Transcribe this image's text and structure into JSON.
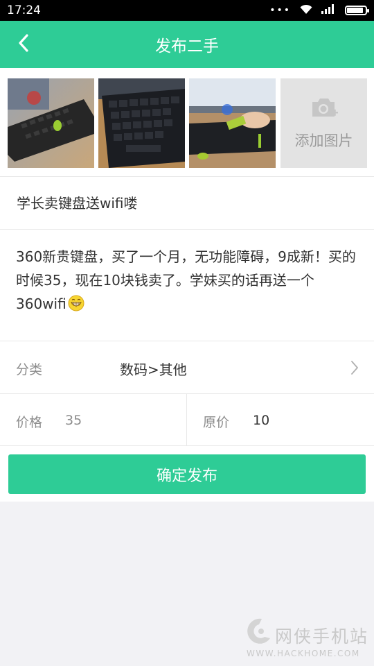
{
  "status_bar": {
    "time": "17:24",
    "notification_dots": "•••",
    "icons": [
      "wifi-icon",
      "signal-icon",
      "battery-icon"
    ],
    "battery_level": 0.9
  },
  "header": {
    "back_icon": "chevron-left-icon",
    "title": "发布二手"
  },
  "photos": [
    {
      "content": "keyboard-photo"
    },
    {
      "content": "keyboard-closeup-photo"
    },
    {
      "content": "usb-wifi-dongle-photo"
    }
  ],
  "add_photo": {
    "icon": "camera-plus-icon",
    "label": "添加图片"
  },
  "post": {
    "title_value": "学长卖键盘送wifi喽",
    "description": "360新贵键盘，买了一个月，无功能障碍，9成新！买的时候35，现在10块钱卖了。学妹买的话再送一个360wifi",
    "description_emoji": "grinning-face-emoji"
  },
  "category": {
    "label": "分类",
    "value": "数码>其他",
    "chevron_icon": "chevron-right-icon"
  },
  "price": {
    "label": "价格",
    "value": "35"
  },
  "original_price": {
    "label": "原价",
    "value": "10"
  },
  "submit": {
    "label": "确定发布"
  },
  "watermark": {
    "name": "网侠手机站",
    "url": "WWW.HACKHOME.COM"
  },
  "colors": {
    "accent": "#2ecc96",
    "status_bar": "#000000",
    "page_bg": "#f2f2f5"
  }
}
